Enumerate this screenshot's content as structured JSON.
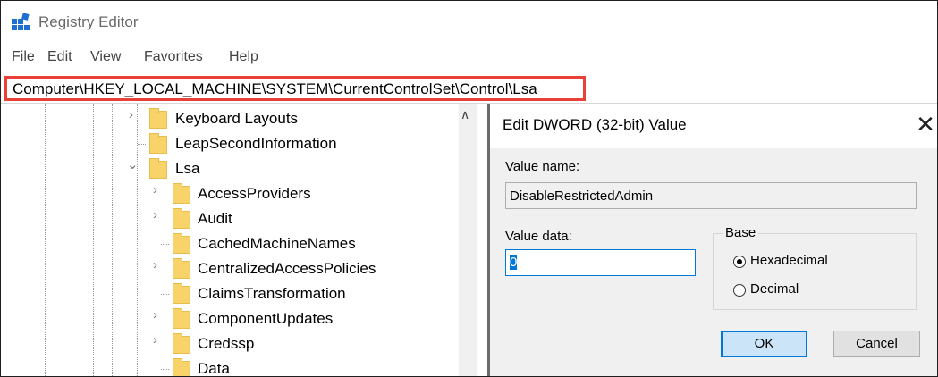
{
  "window": {
    "title": "Registry Editor"
  },
  "menu": [
    "File",
    "Edit",
    "View",
    "Favorites",
    "Help"
  ],
  "address": {
    "path": "Computer\\HKEY_LOCAL_MACHINE\\SYSTEM\\CurrentControlSet\\Control\\Lsa",
    "highlight_color": "#e8413a"
  },
  "tree": {
    "items": [
      {
        "label": "Keyboard Layouts",
        "expander": "collapsed"
      },
      {
        "label": "LeapSecondInformation",
        "expander": "none"
      },
      {
        "label": "Lsa",
        "expander": "expanded",
        "selected": false
      },
      {
        "label": "AccessProviders",
        "expander": "collapsed"
      },
      {
        "label": "Audit",
        "expander": "collapsed"
      },
      {
        "label": "CachedMachineNames",
        "expander": "none"
      },
      {
        "label": "CentralizedAccessPolicies",
        "expander": "collapsed"
      },
      {
        "label": "ClaimsTransformation",
        "expander": "none"
      },
      {
        "label": "ComponentUpdates",
        "expander": "collapsed"
      },
      {
        "label": "Credssp",
        "expander": "collapsed"
      },
      {
        "label": "Data",
        "expander": "none"
      }
    ]
  },
  "dialog": {
    "title": "Edit DWORD (32-bit) Value",
    "value_name_label": "Value name:",
    "value_name": "DisableRestrictedAdmin",
    "value_data_label": "Value data:",
    "value_data": "0",
    "base_label": "Base",
    "base_options": [
      {
        "label": "Hexadecimal",
        "selected": true
      },
      {
        "label": "Decimal",
        "selected": false
      }
    ],
    "ok_label": "OK",
    "cancel_label": "Cancel",
    "accent_color": "#0078d7"
  }
}
